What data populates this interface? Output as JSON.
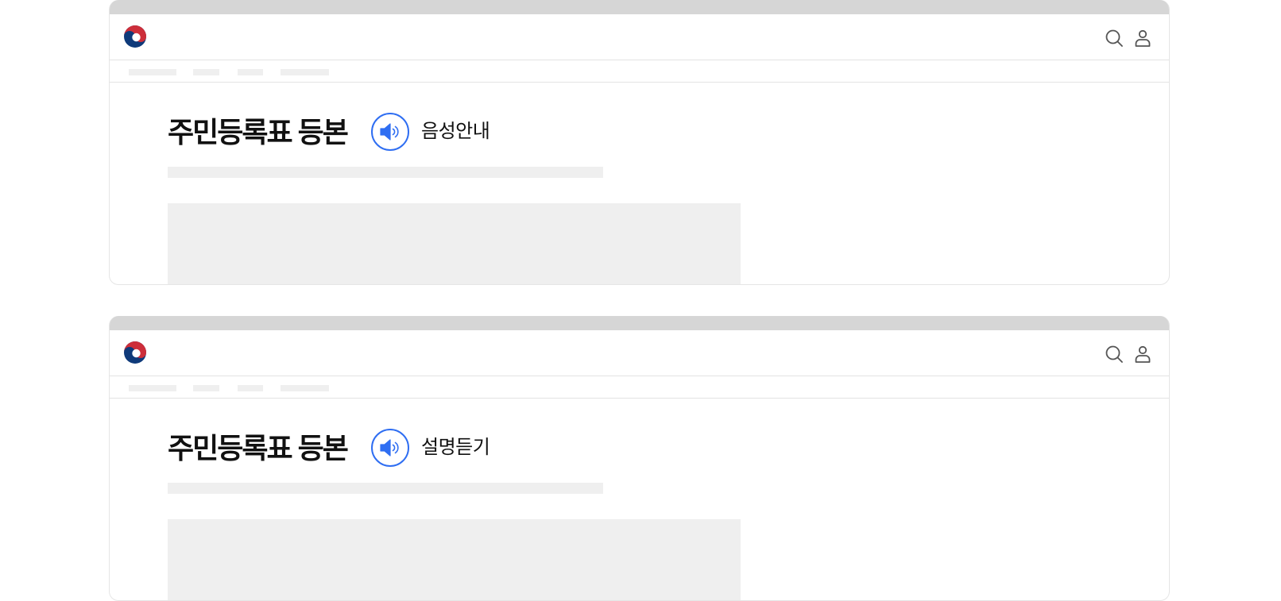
{
  "frames": [
    {
      "title": "주민등록표 등본",
      "audio_button_label": "음성안내"
    },
    {
      "title": "주민등록표 등본",
      "audio_button_label": "설명듣기"
    }
  ],
  "icons": {
    "logo": "korea-government-emblem-icon",
    "search": "search-icon",
    "user": "user-icon",
    "speaker": "speaker-icon"
  },
  "colors": {
    "accent": "#2f6ef2",
    "emblem_red": "#cd2e3a",
    "emblem_blue": "#0f3a7a",
    "placeholder": "#efefef",
    "browser_bar": "#d6d6d6"
  }
}
